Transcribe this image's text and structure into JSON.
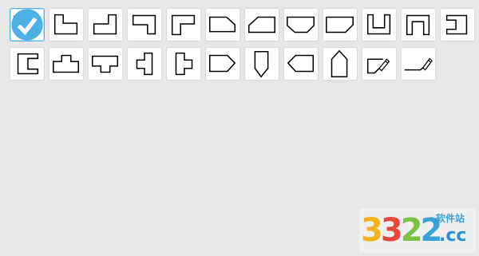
{
  "palette": {
    "selected_index": 0,
    "shapes": [
      "rectangle-shape-icon",
      "l-shape-bottom-left-icon",
      "l-shape-bottom-right-icon",
      "l-shape-top-right-icon",
      "l-shape-top-left-icon",
      "pentagon-right-cut-icon",
      "pentagon-left-cut-icon",
      "pentagon-bottom-cut-icon",
      "pentagon-bottom-right-cut-icon",
      "u-shape-icon",
      "inverted-u-shape-icon",
      "bracket-right-icon",
      "bracket-left-icon",
      "t-shape-up-icon",
      "t-shape-down-icon",
      "t-shape-left-icon",
      "t-shape-right-icon",
      "arrow-pentagon-right-icon",
      "arrow-pentagon-down-icon",
      "arrow-pentagon-left-icon",
      "arrow-pentagon-up-icon",
      "freeform-polygon-pencil-icon",
      "freeform-line-pencil-icon"
    ]
  },
  "watermark": {
    "digits": [
      "3",
      "3",
      "2",
      "2"
    ],
    "site_label": "软件站",
    "suffix": ".cc",
    "colors": [
      "#f6b21a",
      "#e8453c",
      "#7cc242",
      "#3aa0d8"
    ]
  }
}
